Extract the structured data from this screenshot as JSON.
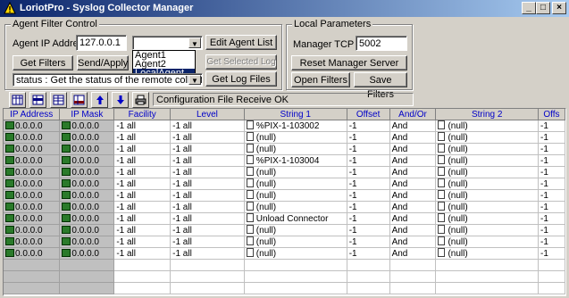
{
  "window": {
    "title": "LoriotPro - Syslog Collector Manager",
    "buttons": [
      "_",
      "□",
      "×"
    ]
  },
  "agent_filter": {
    "legend": "Agent Filter Control",
    "ip_label": "Agent IP Address",
    "ip_value": "127.0.0.1",
    "agent_combo_value": "",
    "agent_options": [
      "Agent1",
      "Agent2",
      "LocalAgent"
    ],
    "agent_selected": "LocalAgent",
    "edit_agent_list": "Edit Agent List",
    "get_selected_log_file": "Get Selected Log File",
    "get_filters": "Get Filters",
    "send_apply": "Send/Apply",
    "command_value": "status : Get the status of the remote collector",
    "get_log_files": "Get Log Files"
  },
  "local_params": {
    "legend": "Local Parameters",
    "port_label": "Manager TCP Port",
    "port_value": "5002",
    "reset_manager": "Reset Manager Server",
    "open_filters": "Open Filters",
    "save_filters": "Save Filters"
  },
  "status_message": "Configuration File Receive OK",
  "table": {
    "columns": [
      "IP Address",
      "IP Mask",
      "Facility",
      "Level",
      "String 1",
      "Offset",
      "And/Or",
      "String 2",
      "Offs"
    ],
    "rows": [
      [
        "0.0.0.0",
        "0.0.0.0",
        "-1 all",
        "-1 all",
        "%PIX-1-103002",
        "-1",
        "And",
        "(null)",
        "-1"
      ],
      [
        "0.0.0.0",
        "0.0.0.0",
        "-1 all",
        "-1 all",
        "(null)",
        "-1",
        "And",
        "(null)",
        "-1"
      ],
      [
        "0.0.0.0",
        "0.0.0.0",
        "-1 all",
        "-1 all",
        "(null)",
        "-1",
        "And",
        "(null)",
        "-1"
      ],
      [
        "0.0.0.0",
        "0.0.0.0",
        "-1 all",
        "-1 all",
        "%PIX-1-103004",
        "-1",
        "And",
        "(null)",
        "-1"
      ],
      [
        "0.0.0.0",
        "0.0.0.0",
        "-1 all",
        "-1 all",
        "(null)",
        "-1",
        "And",
        "(null)",
        "-1"
      ],
      [
        "0.0.0.0",
        "0.0.0.0",
        "-1 all",
        "-1 all",
        "(null)",
        "-1",
        "And",
        "(null)",
        "-1"
      ],
      [
        "0.0.0.0",
        "0.0.0.0",
        "-1 all",
        "-1 all",
        "(null)",
        "-1",
        "And",
        "(null)",
        "-1"
      ],
      [
        "0.0.0.0",
        "0.0.0.0",
        "-1 all",
        "-1 all",
        "(null)",
        "-1",
        "And",
        "(null)",
        "-1"
      ],
      [
        "0.0.0.0",
        "0.0.0.0",
        "-1 all",
        "-1 all",
        "Unload Connector",
        "-1",
        "And",
        "(null)",
        "-1"
      ],
      [
        "0.0.0.0",
        "0.0.0.0",
        "-1 all",
        "-1 all",
        "(null)",
        "-1",
        "And",
        "(null)",
        "-1"
      ],
      [
        "0.0.0.0",
        "0.0.0.0",
        "-1 all",
        "-1 all",
        "(null)",
        "-1",
        "And",
        "(null)",
        "-1"
      ],
      [
        "0.0.0.0",
        "0.0.0.0",
        "-1 all",
        "-1 all",
        "(null)",
        "-1",
        "And",
        "(null)",
        "-1"
      ],
      [
        "",
        "",
        "",
        "",
        "",
        "",
        "",
        "",
        ""
      ],
      [
        "",
        "",
        "",
        "",
        "",
        "",
        "",
        "",
        ""
      ],
      [
        "",
        "",
        "",
        "",
        "",
        "",
        "",
        "",
        ""
      ]
    ]
  }
}
